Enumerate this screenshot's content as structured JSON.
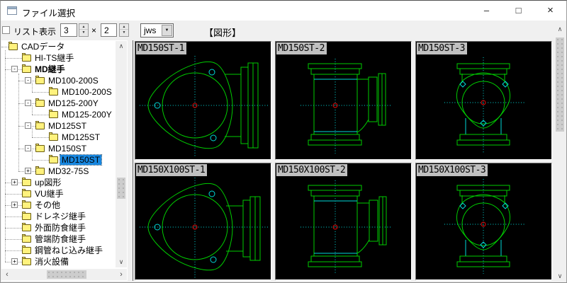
{
  "window": {
    "title": "ファイル選択",
    "minimize_glyph": "–",
    "maximize_glyph": "□",
    "close_glyph": "×"
  },
  "toolbar": {
    "list_label": "リスト表示",
    "cols_value": "3",
    "times_label": "×",
    "rows_value": "2",
    "format_value": "jws",
    "heading": "【図形】"
  },
  "icons": {
    "spin_up": "▲",
    "spin_down": "▼",
    "combo_arrow": "▼",
    "scroll_up": "∧",
    "scroll_down": "∨",
    "scroll_left": "‹",
    "scroll_right": "›"
  },
  "tree": {
    "items": [
      {
        "label": "CADデータ",
        "level": 0,
        "expand": "",
        "bold": false,
        "selected": false
      },
      {
        "label": "HI-TS継手",
        "level": 1,
        "expand": "",
        "bold": false,
        "selected": false
      },
      {
        "label": "MD継手",
        "level": 1,
        "expand": "-",
        "bold": true,
        "selected": false
      },
      {
        "label": "MD100-200S",
        "level": 2,
        "expand": "-",
        "bold": false,
        "selected": false
      },
      {
        "label": "MD100-200S",
        "level": 3,
        "expand": "",
        "bold": false,
        "selected": false
      },
      {
        "label": "MD125-200Y",
        "level": 2,
        "expand": "-",
        "bold": false,
        "selected": false
      },
      {
        "label": "MD125-200Y",
        "level": 3,
        "expand": "",
        "bold": false,
        "selected": false
      },
      {
        "label": "MD125ST",
        "level": 2,
        "expand": "-",
        "bold": false,
        "selected": false
      },
      {
        "label": "MD125ST",
        "level": 3,
        "expand": "",
        "bold": false,
        "selected": false
      },
      {
        "label": "MD150ST",
        "level": 2,
        "expand": "-",
        "bold": false,
        "selected": false
      },
      {
        "label": "MD150ST",
        "level": 3,
        "expand": "",
        "bold": false,
        "selected": true
      },
      {
        "label": "MD32-75S",
        "level": 2,
        "expand": "+",
        "bold": false,
        "selected": false
      },
      {
        "label": "up図形",
        "level": 1,
        "expand": "+",
        "bold": false,
        "selected": false
      },
      {
        "label": "VU継手",
        "level": 1,
        "expand": "",
        "bold": false,
        "selected": false
      },
      {
        "label": "その他",
        "level": 1,
        "expand": "+",
        "bold": false,
        "selected": false
      },
      {
        "label": "ドレネジ継手",
        "level": 1,
        "expand": "",
        "bold": false,
        "selected": false
      },
      {
        "label": "外面防食継手",
        "level": 1,
        "expand": "",
        "bold": false,
        "selected": false
      },
      {
        "label": "管端防食継手",
        "level": 1,
        "expand": "",
        "bold": false,
        "selected": false
      },
      {
        "label": "鋼管ねじ込み継手",
        "level": 1,
        "expand": "",
        "bold": false,
        "selected": false
      },
      {
        "label": "消火設備",
        "level": 1,
        "expand": "+",
        "bold": false,
        "selected": false
      }
    ]
  },
  "tiles": [
    {
      "label": "MD150ST-1",
      "drawing": "flanged-elbow-front-view"
    },
    {
      "label": "MD150ST-2",
      "drawing": "flanged-tee-side-view"
    },
    {
      "label": "MD150ST-3",
      "drawing": "flanged-tee-front-view"
    },
    {
      "label": "MD150X100ST-1",
      "drawing": "reducing-elbow-front-view"
    },
    {
      "label": "MD150X100ST-2",
      "drawing": "reducing-tee-side-view"
    },
    {
      "label": "MD150X100ST-3",
      "drawing": "reducing-tee-front-view"
    }
  ],
  "colors": {
    "drawing_green": "#00cc00",
    "drawing_cyan": "#00d9d9",
    "drawing_center_red": "#e60000",
    "tile_background": "#000000",
    "tile_label_background": "#c0c0c0",
    "selection_blue": "#1787e0",
    "folder_yellow": "#fff27d"
  }
}
